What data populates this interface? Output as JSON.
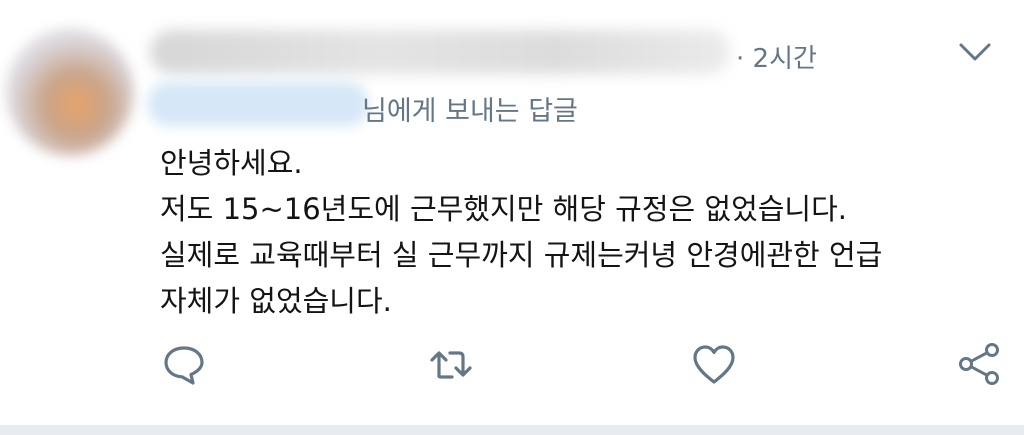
{
  "tweet": {
    "time_label": "· 2시간",
    "reply_to_suffix": "님에게 보내는 답글",
    "body_lines": [
      "안녕하세요.",
      "저도 15~16년도에 근무했지만 해당 규정은 없었습니다.",
      "실제로 교육때부터 실 근무까지 규제는커녕 안경에관한 언급",
      "자체가 없었습니다."
    ]
  },
  "icons": {
    "more": "chevron-down-icon",
    "reply": "speech-bubble-icon",
    "retweet": "retweet-icon",
    "like": "heart-icon",
    "share": "share-icon"
  },
  "colors": {
    "secondary_text": "#657786",
    "body_text": "#141414",
    "background": "#ffffff",
    "divider": "#e6ecf0"
  }
}
